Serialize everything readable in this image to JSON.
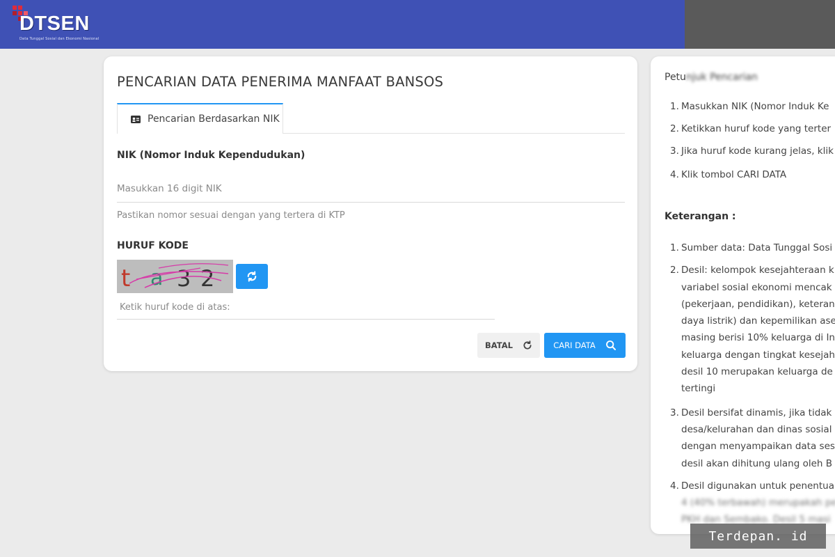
{
  "header": {
    "logo_text": "DTSEN",
    "logo_subtitle": "Data Tunggal Sosial dan Ekonomi Nasional",
    "brand_color": "#3f51b5"
  },
  "main": {
    "title": "PENCARIAN DATA PENERIMA MANFAAT BANSOS",
    "tab_label": "Pencarian Berdasarkan NIK",
    "nik_label": "NIK (Nomor Induk Kependudukan)",
    "nik_placeholder": "Masukkan 16 digit NIK",
    "nik_hint": "Pastikan nomor sesuai dengan yang tertera di KTP",
    "kode_label": "HURUF KODE",
    "captcha_text": [
      "t",
      "a",
      "3",
      "2"
    ],
    "kode_placeholder": "Ketik huruf kode di atas:",
    "batal_label": "BATAL",
    "cari_label": "CARI DATA",
    "accent_color": "#2196f3"
  },
  "side": {
    "title_visible": "Petu",
    "title_blurred": "njuk Pencarian",
    "petunjuk": [
      {
        "num": "1.",
        "text": "Masukkan NIK (Nomor Induk Ke"
      },
      {
        "num": "2.",
        "text": "Ketikkan huruf kode yang terter"
      },
      {
        "num": "3.",
        "text": "Jika huruf kode kurang jelas, klik"
      },
      {
        "num": "4.",
        "text": "Klik tombol CARI DATA"
      }
    ],
    "keterangan_title": "Keterangan :",
    "keterangan": [
      {
        "num": "1.",
        "lines": [
          "Sumber data: Data Tunggal Sosi"
        ]
      },
      {
        "num": "2.",
        "lines": [
          "Desil: kelompok kesejahteraan k",
          "variabel sosial ekonomi mencak",
          "(pekerjaan, pendidikan), keteran",
          "daya listrik) dan kepemilikan ase",
          "masing berisi 10% keluarga di In",
          "keluarga dengan tingkat kesejah",
          "desil 10 merupakan keluarga de",
          "tertingi"
        ]
      },
      {
        "num": "3.",
        "lines": [
          "Desil bersifat dinamis, jika tidak",
          "desa/kelurahan dan dinas sosial",
          "dengan menyampaikan data ses",
          "desil akan dihitung ulang oleh B"
        ]
      },
      {
        "num": "4.",
        "lines": [
          "Desil digunakan untuk penentua"
        ],
        "blurred": [
          "4 (40% terbawah) merupakah pe",
          "PKH dan Sembako. Desil 5 masi"
        ]
      }
    ]
  },
  "watermark": "Terdepan. id"
}
